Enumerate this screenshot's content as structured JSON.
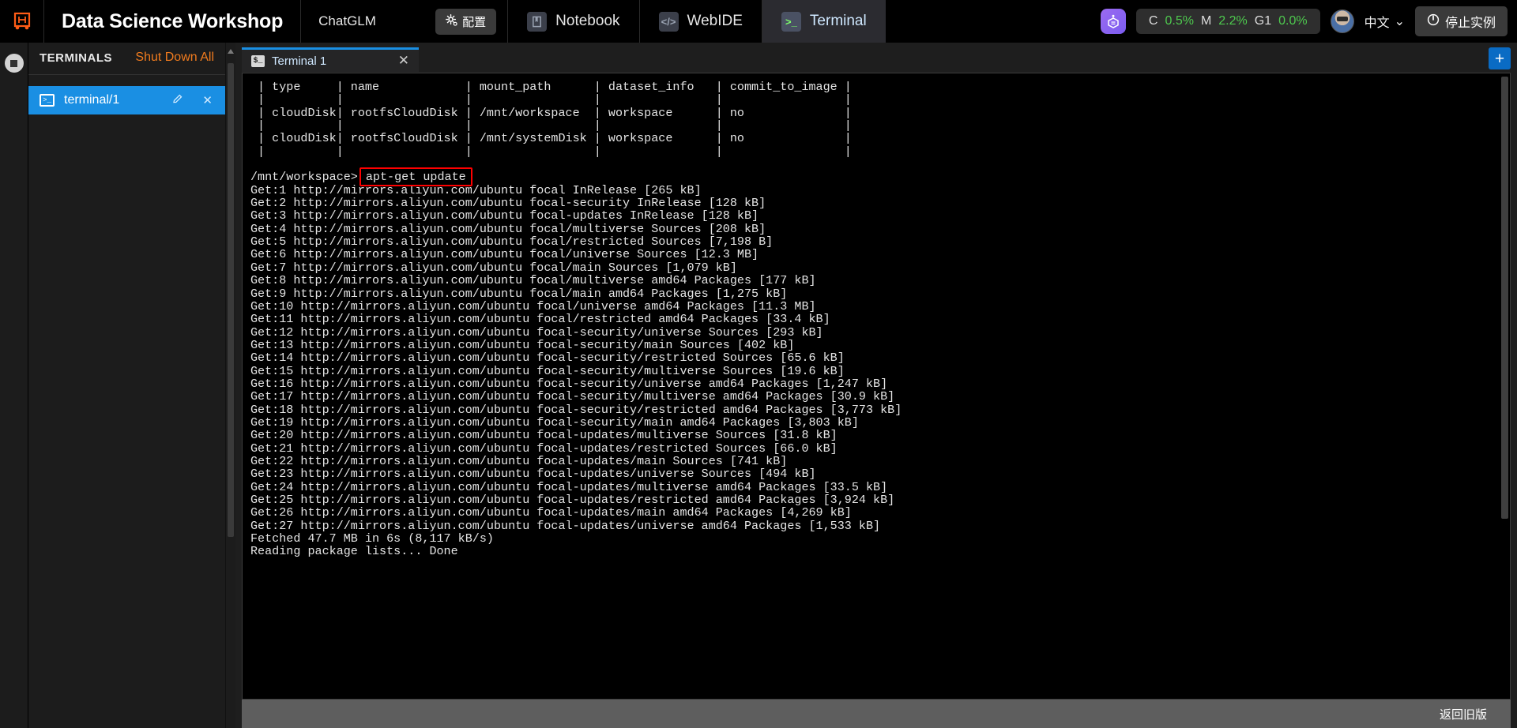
{
  "header": {
    "logo_icon": "app-logo-icon",
    "app_title": "Data Science Workshop",
    "project_name": "ChatGLM",
    "config_button": "配置",
    "config_icon": "gear-icon",
    "tabs": [
      {
        "label": "Notebook",
        "icon": "notebook-icon",
        "active": false
      },
      {
        "label": "WebIDE",
        "icon": "code-icon",
        "active": false
      },
      {
        "label": "Terminal",
        "icon": "terminal-prompt-icon",
        "active": true
      }
    ],
    "assistant_icon": "ai-assistant-icon",
    "metrics": [
      {
        "key": "C",
        "value": "0.5%"
      },
      {
        "key": "M",
        "value": "2.2%"
      },
      {
        "key": "G1",
        "value": "0.0%"
      }
    ],
    "avatar": "user-avatar",
    "language": "中文",
    "language_caret": "⌄",
    "stop_instance": "停止实例",
    "power_icon": "power-icon"
  },
  "sidebar": {
    "title": "TERMINALS",
    "shutdown_all": "Shut Down All",
    "rail_icon": "stop-record-icon",
    "terminals": [
      {
        "label": "terminal/1",
        "icon": "terminal-icon",
        "edit_icon": "pencil-icon",
        "close_icon": "close-icon",
        "active": true
      }
    ]
  },
  "main": {
    "tab": {
      "label": "Terminal 1",
      "icon": "shell-icon",
      "close_icon": "close-icon"
    },
    "add_tab_label": "+",
    "terminal": {
      "table": {
        "headers": [
          "type",
          "name",
          "mount_path",
          "dataset_info",
          "commit_to_image"
        ],
        "rows": [
          [
            "cloudDisk",
            "rootfsCloudDisk",
            "/mnt/workspace",
            "workspace",
            "no"
          ],
          [
            "cloudDisk",
            "rootfsCloudDisk",
            "/mnt/systemDisk",
            "workspace",
            "no"
          ]
        ]
      },
      "prompt": "/mnt/workspace>",
      "command": "apt-get update",
      "command_highlight_color": "#ff0000",
      "output": [
        "Get:1 http://mirrors.aliyun.com/ubuntu focal InRelease [265 kB]",
        "Get:2 http://mirrors.aliyun.com/ubuntu focal-security InRelease [128 kB]",
        "Get:3 http://mirrors.aliyun.com/ubuntu focal-updates InRelease [128 kB]",
        "Get:4 http://mirrors.aliyun.com/ubuntu focal/multiverse Sources [208 kB]",
        "Get:5 http://mirrors.aliyun.com/ubuntu focal/restricted Sources [7,198 B]",
        "Get:6 http://mirrors.aliyun.com/ubuntu focal/universe Sources [12.3 MB]",
        "Get:7 http://mirrors.aliyun.com/ubuntu focal/main Sources [1,079 kB]",
        "Get:8 http://mirrors.aliyun.com/ubuntu focal/multiverse amd64 Packages [177 kB]",
        "Get:9 http://mirrors.aliyun.com/ubuntu focal/main amd64 Packages [1,275 kB]",
        "Get:10 http://mirrors.aliyun.com/ubuntu focal/universe amd64 Packages [11.3 MB]",
        "Get:11 http://mirrors.aliyun.com/ubuntu focal/restricted amd64 Packages [33.4 kB]",
        "Get:12 http://mirrors.aliyun.com/ubuntu focal-security/universe Sources [293 kB]",
        "Get:13 http://mirrors.aliyun.com/ubuntu focal-security/main Sources [402 kB]",
        "Get:14 http://mirrors.aliyun.com/ubuntu focal-security/restricted Sources [65.6 kB]",
        "Get:15 http://mirrors.aliyun.com/ubuntu focal-security/multiverse Sources [19.6 kB]",
        "Get:16 http://mirrors.aliyun.com/ubuntu focal-security/universe amd64 Packages [1,247 kB]",
        "Get:17 http://mirrors.aliyun.com/ubuntu focal-security/multiverse amd64 Packages [30.9 kB]",
        "Get:18 http://mirrors.aliyun.com/ubuntu focal-security/restricted amd64 Packages [3,773 kB]",
        "Get:19 http://mirrors.aliyun.com/ubuntu focal-security/main amd64 Packages [3,803 kB]",
        "Get:20 http://mirrors.aliyun.com/ubuntu focal-updates/multiverse Sources [31.8 kB]",
        "Get:21 http://mirrors.aliyun.com/ubuntu focal-updates/restricted Sources [66.0 kB]",
        "Get:22 http://mirrors.aliyun.com/ubuntu focal-updates/main Sources [741 kB]",
        "Get:23 http://mirrors.aliyun.com/ubuntu focal-updates/universe Sources [494 kB]",
        "Get:24 http://mirrors.aliyun.com/ubuntu focal-updates/multiverse amd64 Packages [33.5 kB]",
        "Get:25 http://mirrors.aliyun.com/ubuntu focal-updates/restricted amd64 Packages [3,924 kB]",
        "Get:26 http://mirrors.aliyun.com/ubuntu focal-updates/main amd64 Packages [4,269 kB]",
        "Get:27 http://mirrors.aliyun.com/ubuntu focal-updates/universe amd64 Packages [1,533 kB]",
        "Fetched 47.7 MB in 6s (8,117 kB/s)",
        "Reading package lists... Done"
      ]
    }
  },
  "statusbar": {
    "legacy_link": "返回旧版"
  }
}
